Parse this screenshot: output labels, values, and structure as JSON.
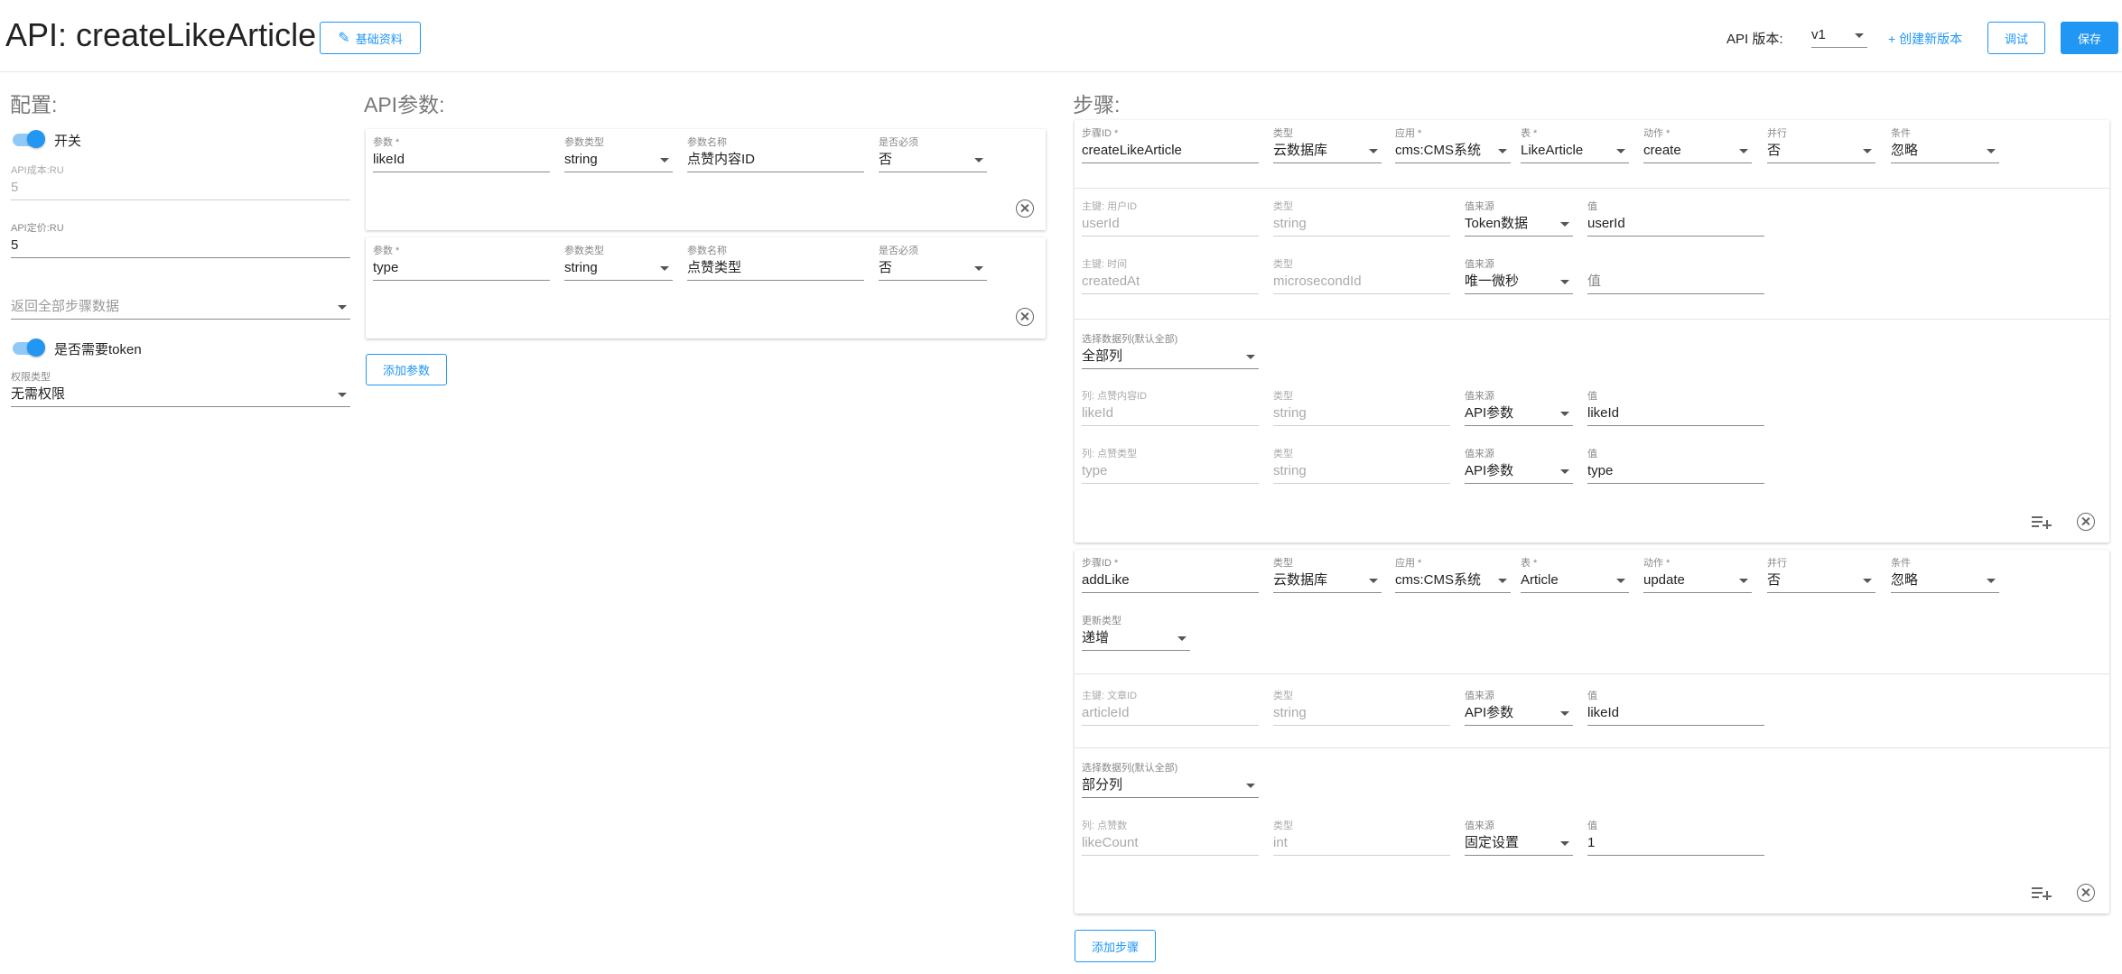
{
  "header": {
    "title": "API: createLikeArticle",
    "basic_info_label": "基础资料",
    "version_label": "API 版本:",
    "version_value": "v1",
    "create_version_label": "+ 创建新版本",
    "debug_label": "调试",
    "save_label": "保存"
  },
  "config": {
    "section_title": "配置:",
    "switch_label": "开关",
    "cost_label": "API成本:RU",
    "cost_value": "5",
    "price_label": "API定价:RU",
    "price_value": "5",
    "return_all_placeholder": "返回全部步骤数据",
    "token_label": "是否需要token",
    "perm_label": "权限类型",
    "perm_value": "无需权限"
  },
  "params": {
    "section_title": "API参数:",
    "col_labels": {
      "name": "参数 *",
      "type": "参数类型",
      "display": "参数名称",
      "required": "是否必须"
    },
    "items": [
      {
        "name": "likeId",
        "type": "string",
        "display": "点赞内容ID",
        "required": "否"
      },
      {
        "name": "type",
        "type": "string",
        "display": "点赞类型",
        "required": "否"
      }
    ],
    "add_label": "添加参数"
  },
  "steps": {
    "section_title": "步骤:",
    "head_labels": {
      "step_id": "步骤ID *",
      "db_type": "类型",
      "app": "应用 *",
      "table": "表 *",
      "action": "动作 *",
      "parallel": "并行",
      "condition": "条件"
    },
    "row_labels": {
      "type": "类型",
      "source": "值来源",
      "value": "值",
      "select_cols": "选择数据列(默认全部)",
      "update_type": "更新类型"
    },
    "step1": {
      "step_id": "createLikeArticle",
      "db_type": "云数据库",
      "app": "cms:CMS系统",
      "table": "LikeArticle",
      "action": "create",
      "parallel": "否",
      "condition": "忽略",
      "keys": [
        {
          "label": "主键: 用户ID",
          "field": "userId",
          "type": "string",
          "source": "Token数据",
          "value": "userId"
        },
        {
          "label": "主键: 时间",
          "field": "createdAt",
          "type": "microsecondId",
          "source": "唯一微秒",
          "value": "值"
        }
      ],
      "select_cols": "全部列",
      "cols": [
        {
          "label": "列: 点赞内容ID",
          "field": "likeId",
          "type": "string",
          "source": "API参数",
          "value": "likeId"
        },
        {
          "label": "列: 点赞类型",
          "field": "type",
          "type": "string",
          "source": "API参数",
          "value": "type"
        }
      ]
    },
    "step2": {
      "step_id": "addLike",
      "db_type": "云数据库",
      "app": "cms:CMS系统",
      "table": "Article",
      "action": "update",
      "parallel": "否",
      "condition": "忽略",
      "update_type": "递增",
      "keys": [
        {
          "label": "主键: 文章ID",
          "field": "articleId",
          "type": "string",
          "source": "API参数",
          "value": "likeId"
        }
      ],
      "select_cols": "部分列",
      "cols": [
        {
          "label": "列: 点赞数",
          "field": "likeCount",
          "type": "int",
          "source": "固定设置",
          "value": "1"
        }
      ]
    },
    "add_label": "添加步骤"
  }
}
